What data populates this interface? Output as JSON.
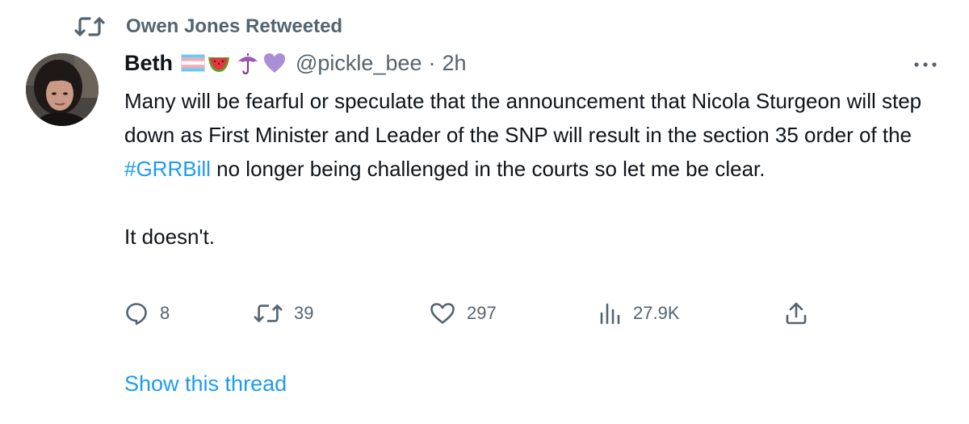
{
  "retweet_header": {
    "text": "Owen Jones Retweeted",
    "icon": "retweet-icon"
  },
  "author": {
    "name": "Beth",
    "emojis": [
      "transgender-flag",
      "watermelon",
      "umbrella",
      "purple-heart"
    ],
    "handle": "@pickle_bee",
    "separator": "·",
    "time": "2h",
    "avatar": "profile-photo"
  },
  "more_icon": "more-horizontal-icon",
  "body": {
    "paragraph1_before": "Many will be fearful or speculate that the announcement that Nicola Sturgeon will step down as First Minister and Leader of the SNP will result in the section 35 order of the ",
    "hashtag": "#GRRBill",
    "paragraph1_after": " no longer being challenged in the courts so let me be clear.",
    "paragraph2": "It doesn't."
  },
  "actions": {
    "replies": "8",
    "retweets": "39",
    "likes": "297",
    "views": "27.9K"
  },
  "show_thread": "Show this thread",
  "colors": {
    "link": "#1d9bf0",
    "secondary": "#536471",
    "text": "#0f1419"
  }
}
